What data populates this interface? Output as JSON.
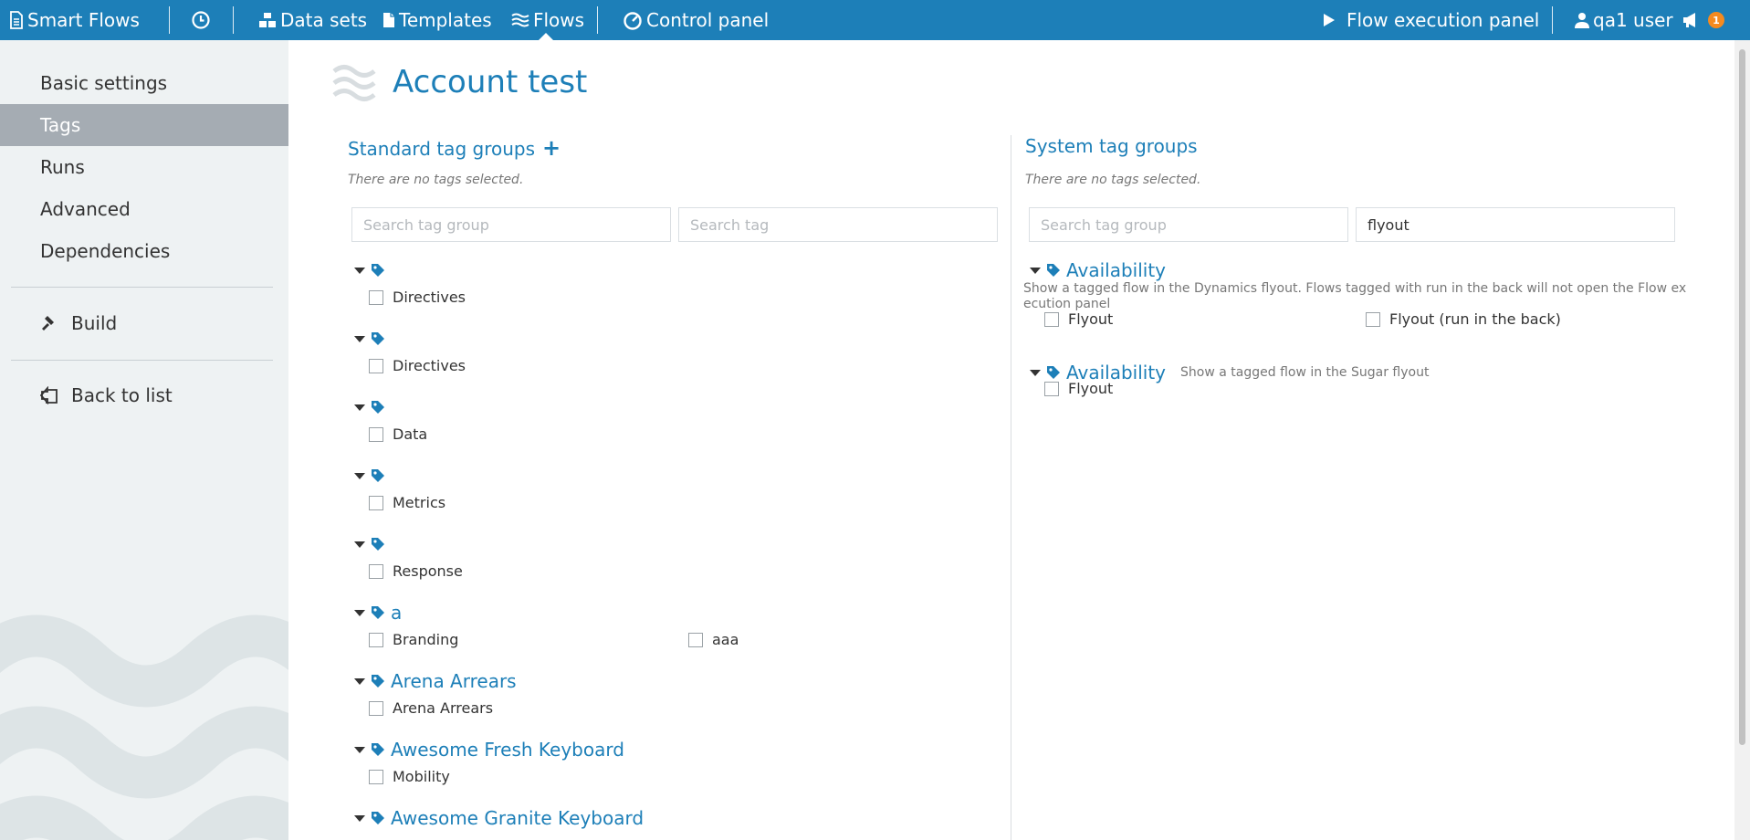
{
  "topbar": {
    "brand": "Smart Flows",
    "nav": [
      "Data sets",
      "Templates",
      "Flows",
      "Control panel"
    ],
    "flow_execution_panel": "Flow execution panel",
    "user": "qa1 user",
    "notification_count": "1"
  },
  "sidebar": {
    "items": [
      "Basic settings",
      "Tags",
      "Runs",
      "Advanced",
      "Dependencies"
    ],
    "active": "Tags",
    "build": "Build",
    "back": "Back to list"
  },
  "page": {
    "title": "Account test"
  },
  "standard": {
    "title": "Standard tag groups",
    "add_symbol": "+",
    "empty_note": "There are no tags selected.",
    "search_group_placeholder": "Search tag group",
    "search_tag_placeholder": "Search tag",
    "groups": [
      {
        "name": "",
        "tags": [
          "Directives"
        ]
      },
      {
        "name": "",
        "tags": [
          "Directives"
        ]
      },
      {
        "name": "",
        "tags": [
          "Data"
        ]
      },
      {
        "name": "",
        "tags": [
          "Metrics"
        ]
      },
      {
        "name": "",
        "tags": [
          "Response"
        ]
      },
      {
        "name": "a",
        "tags": [
          "Branding",
          "aaa"
        ]
      },
      {
        "name": "Arena Arrears",
        "tags": [
          "Arena Arrears"
        ]
      },
      {
        "name": "Awesome Fresh Keyboard",
        "tags": [
          "Mobility"
        ]
      },
      {
        "name": "Awesome Granite Keyboard",
        "tags": []
      }
    ]
  },
  "system": {
    "title": "System tag groups",
    "empty_note": "There are no tags selected.",
    "search_group_placeholder": "Search tag group",
    "search_tag_value": "flyout",
    "groups": [
      {
        "name": "Availability",
        "description": "Show a tagged flow in the Dynamics flyout. Flows tagged with run in the back will not open the Flow execution panel",
        "description_lines": [
          "Show a tagged flow in the Dynamics flyout. Flows tagged with run in the back will not open the Flow ex",
          "ecution panel"
        ],
        "tags": [
          "Flyout",
          "Flyout (run in the back)"
        ]
      },
      {
        "name": "Availability",
        "description": "Show a tagged flow in the Sugar flyout",
        "tags": [
          "Flyout"
        ]
      }
    ]
  },
  "colors": {
    "topbar_bg": "#1d7fb8",
    "accent": "#1d7fb8",
    "sidebar_bg": "#eef2f3",
    "sidebar_active_bg": "#a5acb3",
    "badge": "#f58a1f"
  },
  "icons": [
    "document-icon",
    "clock-icon",
    "datasets-icon",
    "template-icon",
    "flows-icon",
    "gauge-icon",
    "play-icon",
    "user-icon",
    "megaphone-icon",
    "hammer-icon",
    "back-icon",
    "tag-icon",
    "caret-down-icon",
    "plus-icon"
  ]
}
